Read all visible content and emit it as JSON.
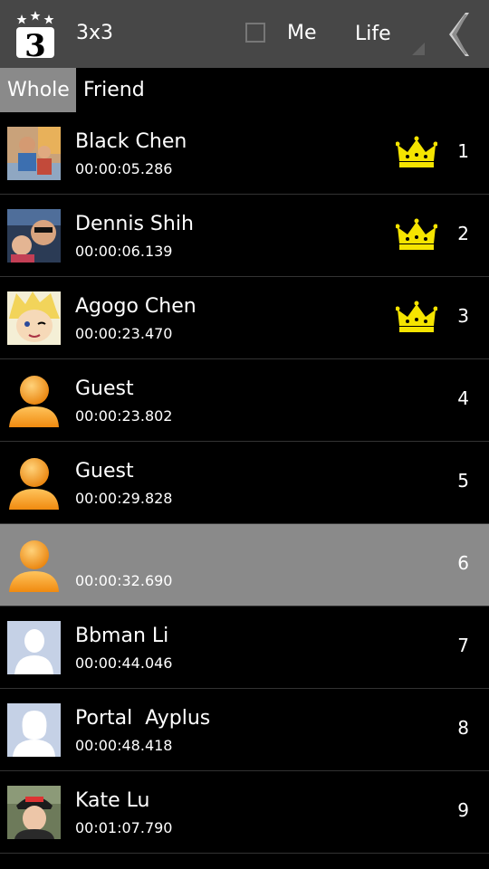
{
  "header": {
    "title": "3x3",
    "me_label": "Me",
    "mode_label": "Life"
  },
  "tabs": [
    {
      "label": "Whole",
      "active": true
    },
    {
      "label": "Friend",
      "active": false
    }
  ],
  "rows": [
    {
      "name": "Black Chen",
      "time": "00:00:05.286",
      "rank": "1",
      "avatar": "photo-family",
      "crown": true
    },
    {
      "name": "Dennis Shih",
      "time": "00:00:06.139",
      "rank": "2",
      "avatar": "photo-selfie",
      "crown": true
    },
    {
      "name": "Agogo Chen",
      "time": "00:00:23.470",
      "rank": "3",
      "avatar": "anime-boy",
      "crown": true
    },
    {
      "name": "Guest",
      "time": "00:00:23.802",
      "rank": "4",
      "avatar": "guest-orange",
      "crown": false
    },
    {
      "name": "Guest",
      "time": "00:00:29.828",
      "rank": "5",
      "avatar": "guest-orange",
      "crown": false
    },
    {
      "name": "",
      "time": "00:00:32.690",
      "rank": "6",
      "avatar": "guest-orange",
      "crown": false,
      "highlight": true
    },
    {
      "name": "Bbman Li",
      "time": "00:00:44.046",
      "rank": "7",
      "avatar": "silhouette-male",
      "crown": false
    },
    {
      "name": "Portal  Ayplus",
      "time": "00:00:48.418",
      "rank": "8",
      "avatar": "silhouette-female",
      "crown": false
    },
    {
      "name": "Kate Lu",
      "time": "00:01:07.790",
      "rank": "9",
      "avatar": "photo-woman",
      "crown": false
    }
  ],
  "colors": {
    "header_bg": "#474747",
    "active_tab_bg": "#8a8a8a",
    "crown": "#f5e400",
    "guest_orange": "#f39a1c"
  }
}
